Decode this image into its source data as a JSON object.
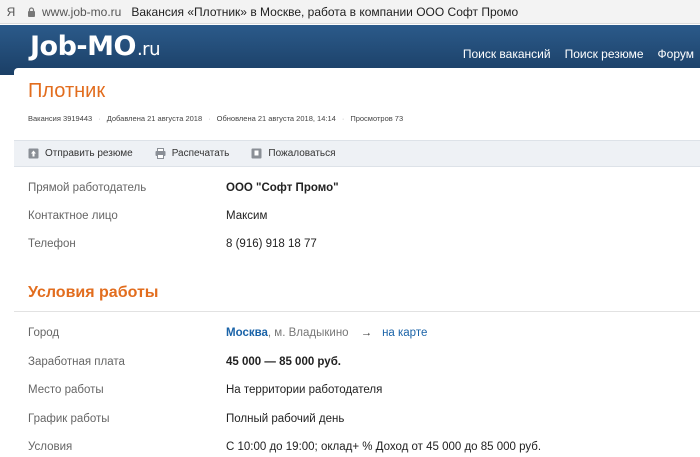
{
  "browser": {
    "ya_label": "Я",
    "url": "www.job-mo.ru",
    "page_title": "Вакансия «Плотник» в Москве, работа в компании ООО Софт Промо"
  },
  "header": {
    "logo_main": "Job-MO",
    "logo_domain": ".ru",
    "nav": [
      "Поиск вакансий",
      "Поиск резюме",
      "Форум"
    ]
  },
  "vacancy": {
    "title": "Плотник",
    "meta": {
      "id": "Вакансия 3919443",
      "added": "Добавлена 21 августа 2018",
      "updated": "Обновлена 21 августа 2018, 14:14",
      "views": "Просмотров 73"
    },
    "actions": {
      "send_resume": "Отправить резюме",
      "print": "Распечатать",
      "complain": "Пожаловаться"
    },
    "contacts": {
      "employer_label": "Прямой работодатель",
      "employer_value": "ООО \"Софт Промо\"",
      "contact_label": "Контактное лицо",
      "contact_value": "Максим",
      "phone_label": "Телефон",
      "phone_value": "8 (916) 918 18 77"
    },
    "conditions": {
      "section_title": "Условия работы",
      "city_label": "Город",
      "city_value": "Москва",
      "metro": ", м. Владыкино",
      "arrow": "→",
      "map_link": "на карте",
      "salary_label": "Заработная плата",
      "salary_value": "45 000 — 85 000 руб.",
      "place_label": "Место работы",
      "place_value": "На территории работодателя",
      "schedule_label": "График работы",
      "schedule_value": "Полный рабочий день",
      "terms_label": "Условия",
      "terms_value": "С 10:00 до 19:00; оклад+ % Доход от 45 000 до 85 000 руб."
    }
  }
}
